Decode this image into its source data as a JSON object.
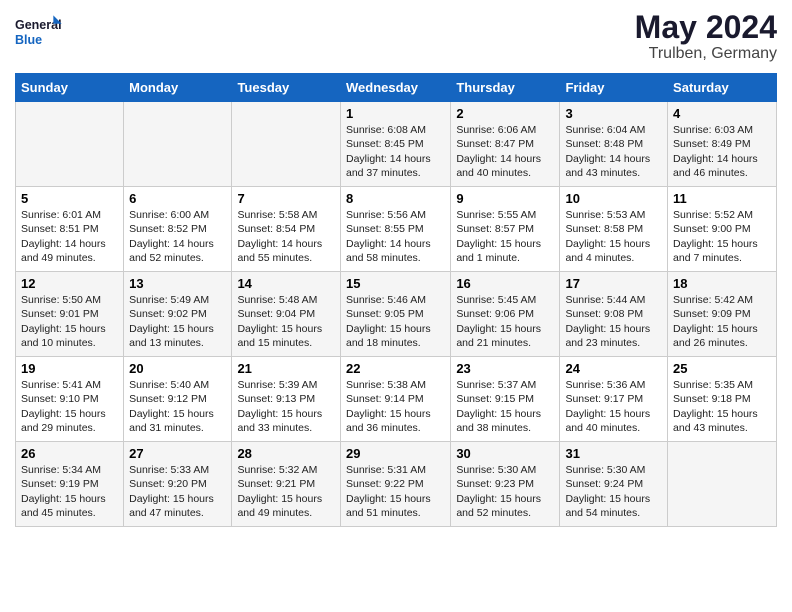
{
  "header": {
    "logo_line1": "General",
    "logo_line2": "Blue",
    "month": "May 2024",
    "location": "Trulben, Germany"
  },
  "days_of_week": [
    "Sunday",
    "Monday",
    "Tuesday",
    "Wednesday",
    "Thursday",
    "Friday",
    "Saturday"
  ],
  "weeks": [
    [
      {
        "day": "",
        "info": ""
      },
      {
        "day": "",
        "info": ""
      },
      {
        "day": "",
        "info": ""
      },
      {
        "day": "1",
        "info": "Sunrise: 6:08 AM\nSunset: 8:45 PM\nDaylight: 14 hours\nand 37 minutes."
      },
      {
        "day": "2",
        "info": "Sunrise: 6:06 AM\nSunset: 8:47 PM\nDaylight: 14 hours\nand 40 minutes."
      },
      {
        "day": "3",
        "info": "Sunrise: 6:04 AM\nSunset: 8:48 PM\nDaylight: 14 hours\nand 43 minutes."
      },
      {
        "day": "4",
        "info": "Sunrise: 6:03 AM\nSunset: 8:49 PM\nDaylight: 14 hours\nand 46 minutes."
      }
    ],
    [
      {
        "day": "5",
        "info": "Sunrise: 6:01 AM\nSunset: 8:51 PM\nDaylight: 14 hours\nand 49 minutes."
      },
      {
        "day": "6",
        "info": "Sunrise: 6:00 AM\nSunset: 8:52 PM\nDaylight: 14 hours\nand 52 minutes."
      },
      {
        "day": "7",
        "info": "Sunrise: 5:58 AM\nSunset: 8:54 PM\nDaylight: 14 hours\nand 55 minutes."
      },
      {
        "day": "8",
        "info": "Sunrise: 5:56 AM\nSunset: 8:55 PM\nDaylight: 14 hours\nand 58 minutes."
      },
      {
        "day": "9",
        "info": "Sunrise: 5:55 AM\nSunset: 8:57 PM\nDaylight: 15 hours\nand 1 minute."
      },
      {
        "day": "10",
        "info": "Sunrise: 5:53 AM\nSunset: 8:58 PM\nDaylight: 15 hours\nand 4 minutes."
      },
      {
        "day": "11",
        "info": "Sunrise: 5:52 AM\nSunset: 9:00 PM\nDaylight: 15 hours\nand 7 minutes."
      }
    ],
    [
      {
        "day": "12",
        "info": "Sunrise: 5:50 AM\nSunset: 9:01 PM\nDaylight: 15 hours\nand 10 minutes."
      },
      {
        "day": "13",
        "info": "Sunrise: 5:49 AM\nSunset: 9:02 PM\nDaylight: 15 hours\nand 13 minutes."
      },
      {
        "day": "14",
        "info": "Sunrise: 5:48 AM\nSunset: 9:04 PM\nDaylight: 15 hours\nand 15 minutes."
      },
      {
        "day": "15",
        "info": "Sunrise: 5:46 AM\nSunset: 9:05 PM\nDaylight: 15 hours\nand 18 minutes."
      },
      {
        "day": "16",
        "info": "Sunrise: 5:45 AM\nSunset: 9:06 PM\nDaylight: 15 hours\nand 21 minutes."
      },
      {
        "day": "17",
        "info": "Sunrise: 5:44 AM\nSunset: 9:08 PM\nDaylight: 15 hours\nand 23 minutes."
      },
      {
        "day": "18",
        "info": "Sunrise: 5:42 AM\nSunset: 9:09 PM\nDaylight: 15 hours\nand 26 minutes."
      }
    ],
    [
      {
        "day": "19",
        "info": "Sunrise: 5:41 AM\nSunset: 9:10 PM\nDaylight: 15 hours\nand 29 minutes."
      },
      {
        "day": "20",
        "info": "Sunrise: 5:40 AM\nSunset: 9:12 PM\nDaylight: 15 hours\nand 31 minutes."
      },
      {
        "day": "21",
        "info": "Sunrise: 5:39 AM\nSunset: 9:13 PM\nDaylight: 15 hours\nand 33 minutes."
      },
      {
        "day": "22",
        "info": "Sunrise: 5:38 AM\nSunset: 9:14 PM\nDaylight: 15 hours\nand 36 minutes."
      },
      {
        "day": "23",
        "info": "Sunrise: 5:37 AM\nSunset: 9:15 PM\nDaylight: 15 hours\nand 38 minutes."
      },
      {
        "day": "24",
        "info": "Sunrise: 5:36 AM\nSunset: 9:17 PM\nDaylight: 15 hours\nand 40 minutes."
      },
      {
        "day": "25",
        "info": "Sunrise: 5:35 AM\nSunset: 9:18 PM\nDaylight: 15 hours\nand 43 minutes."
      }
    ],
    [
      {
        "day": "26",
        "info": "Sunrise: 5:34 AM\nSunset: 9:19 PM\nDaylight: 15 hours\nand 45 minutes."
      },
      {
        "day": "27",
        "info": "Sunrise: 5:33 AM\nSunset: 9:20 PM\nDaylight: 15 hours\nand 47 minutes."
      },
      {
        "day": "28",
        "info": "Sunrise: 5:32 AM\nSunset: 9:21 PM\nDaylight: 15 hours\nand 49 minutes."
      },
      {
        "day": "29",
        "info": "Sunrise: 5:31 AM\nSunset: 9:22 PM\nDaylight: 15 hours\nand 51 minutes."
      },
      {
        "day": "30",
        "info": "Sunrise: 5:30 AM\nSunset: 9:23 PM\nDaylight: 15 hours\nand 52 minutes."
      },
      {
        "day": "31",
        "info": "Sunrise: 5:30 AM\nSunset: 9:24 PM\nDaylight: 15 hours\nand 54 minutes."
      },
      {
        "day": "",
        "info": ""
      }
    ]
  ]
}
